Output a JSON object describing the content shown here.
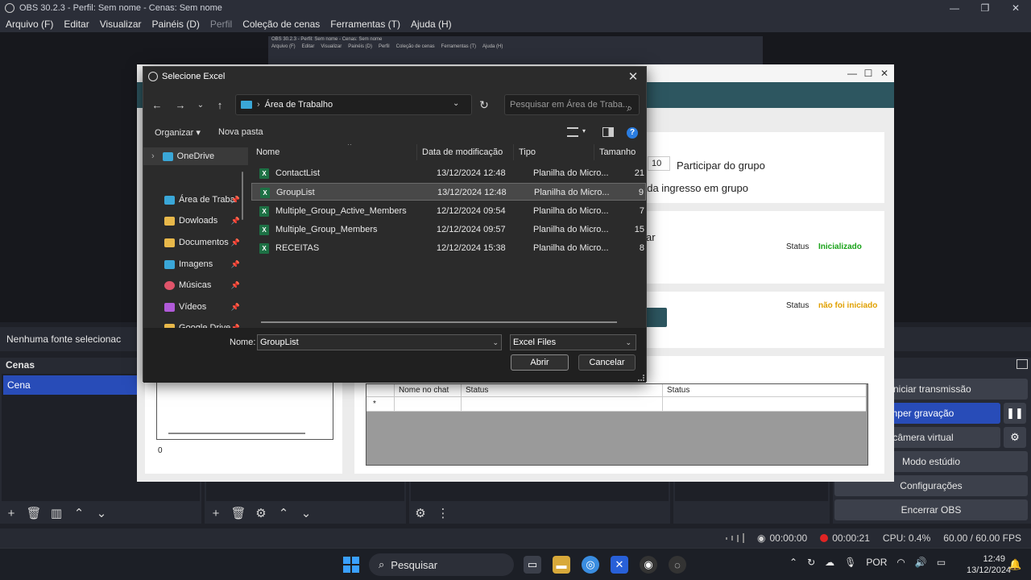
{
  "obs": {
    "title": "OBS 30.2.3 - Perfil: Sem nome - Cenas: Sem nome",
    "menu": [
      "Arquivo (F)",
      "Editar",
      "Visualizar",
      "Painéis (D)",
      "Perfil",
      "Coleção de cenas",
      "Ferramentas (T)",
      "Ajuda (H)"
    ],
    "nested_title": "OBS 30.2.3 - Perfil: Sem nome - Cenas: Sem nome",
    "no_source": "Nenhuma fonte selecionac",
    "scenes_title": "Cenas",
    "scene_item": "Cena",
    "controls": {
      "start_stream": "iniciar transmissão",
      "stop_recording": "romper gravação",
      "virtual_camera": "ar câmera virtual",
      "studio_mode": "Modo estúdio",
      "settings": "Configurações",
      "exit": "Encerrar OBS"
    },
    "status": {
      "stream_time": "00:00:00",
      "rec_time": "00:00:21",
      "cpu": "CPU: 0.4%",
      "fps": "60.00 / 60.00 FPS"
    }
  },
  "app": {
    "group_number": "10",
    "join_group": "Participar do grupo",
    "group_entry": "ada ingresso em grupo",
    "partial_text": "ar",
    "status_label_1": "Status",
    "status_value_1": "Inicializado",
    "status_color_1": "#1aa31a",
    "status_label_2": "Status",
    "status_value_2": "não foi iniciado",
    "status_color_2": "#e0a000",
    "left_count": "0",
    "table": {
      "columns": [
        "Nome no chat",
        "Status",
        "Status"
      ],
      "row_marker": "*"
    }
  },
  "dialog": {
    "title": "Selecione Excel",
    "path": "Área de Trabalho",
    "search_placeholder": "Pesquisar em Área de Traba...",
    "organize": "Organizar",
    "new_folder": "Nova pasta",
    "help": "?",
    "nav": [
      {
        "label": "OneDrive",
        "icon": "onedrive-icon",
        "color": "#3aa7d8",
        "pinned": false
      },
      {
        "label": "Área de Trabal",
        "icon": "desktop-icon",
        "color": "#3aa7d8",
        "pinned": true
      },
      {
        "label": "Dowloads",
        "icon": "downloads-icon",
        "color": "#e8b84a",
        "pinned": true
      },
      {
        "label": "Documentos",
        "icon": "documents-icon",
        "color": "#e8b84a",
        "pinned": true
      },
      {
        "label": "Imagens",
        "icon": "images-icon",
        "color": "#3aa7d8",
        "pinned": true
      },
      {
        "label": "Músicas",
        "icon": "music-icon",
        "color": "#e0546a",
        "pinned": true
      },
      {
        "label": "Vídeos",
        "icon": "videos-icon",
        "color": "#b05ad8",
        "pinned": true
      },
      {
        "label": "Google Drive",
        "icon": "google-drive-icon",
        "color": "#e8b84a",
        "pinned": true
      }
    ],
    "columns": {
      "name": "Nome",
      "modified": "Data de modificação",
      "type": "Tipo",
      "size": "Tamanho"
    },
    "files": [
      {
        "name": "ContactList",
        "modified": "13/12/2024 12:48",
        "type": "Planilha do Micro...",
        "size": "21"
      },
      {
        "name": "GroupList",
        "modified": "13/12/2024 12:48",
        "type": "Planilha do Micro...",
        "size": "9"
      },
      {
        "name": "Multiple_Group_Active_Members",
        "modified": "12/12/2024 09:54",
        "type": "Planilha do Micro...",
        "size": "7"
      },
      {
        "name": "Multiple_Group_Members",
        "modified": "12/12/2024 09:57",
        "type": "Planilha do Micro...",
        "size": "15"
      },
      {
        "name": "RECEITAS",
        "modified": "12/12/2024 15:38",
        "type": "Planilha do Micro...",
        "size": "8"
      }
    ],
    "selected_index": 1,
    "name_label": "Nome:",
    "name_value": "GroupList",
    "filter": "Excel Files",
    "open": "Abrir",
    "cancel": "Cancelar"
  },
  "taskbar": {
    "search": "Pesquisar",
    "language": "POR",
    "time": "12:49",
    "date": "13/12/2024"
  }
}
